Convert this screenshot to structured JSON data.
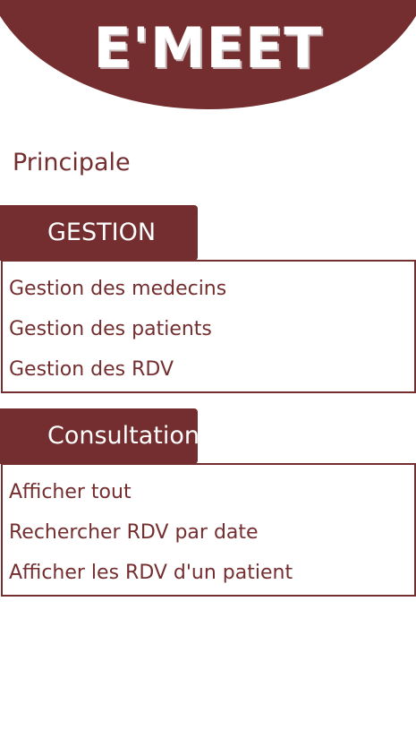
{
  "app": {
    "logo_text": "E'MEET"
  },
  "page": {
    "title": "Principale"
  },
  "sections": {
    "gestion": {
      "label": "GESTION",
      "items": [
        "Gestion des medecins",
        "Gestion des patients",
        "Gestion des RDV"
      ]
    },
    "consultation": {
      "label": "Consultation",
      "items": [
        "Afficher tout",
        "Rechercher RDV par date",
        "Afficher les RDV d'un patient"
      ]
    }
  },
  "colors": {
    "brand": "#742e2f",
    "background": "#ffffff",
    "text_on_brand": "#ffffff"
  }
}
